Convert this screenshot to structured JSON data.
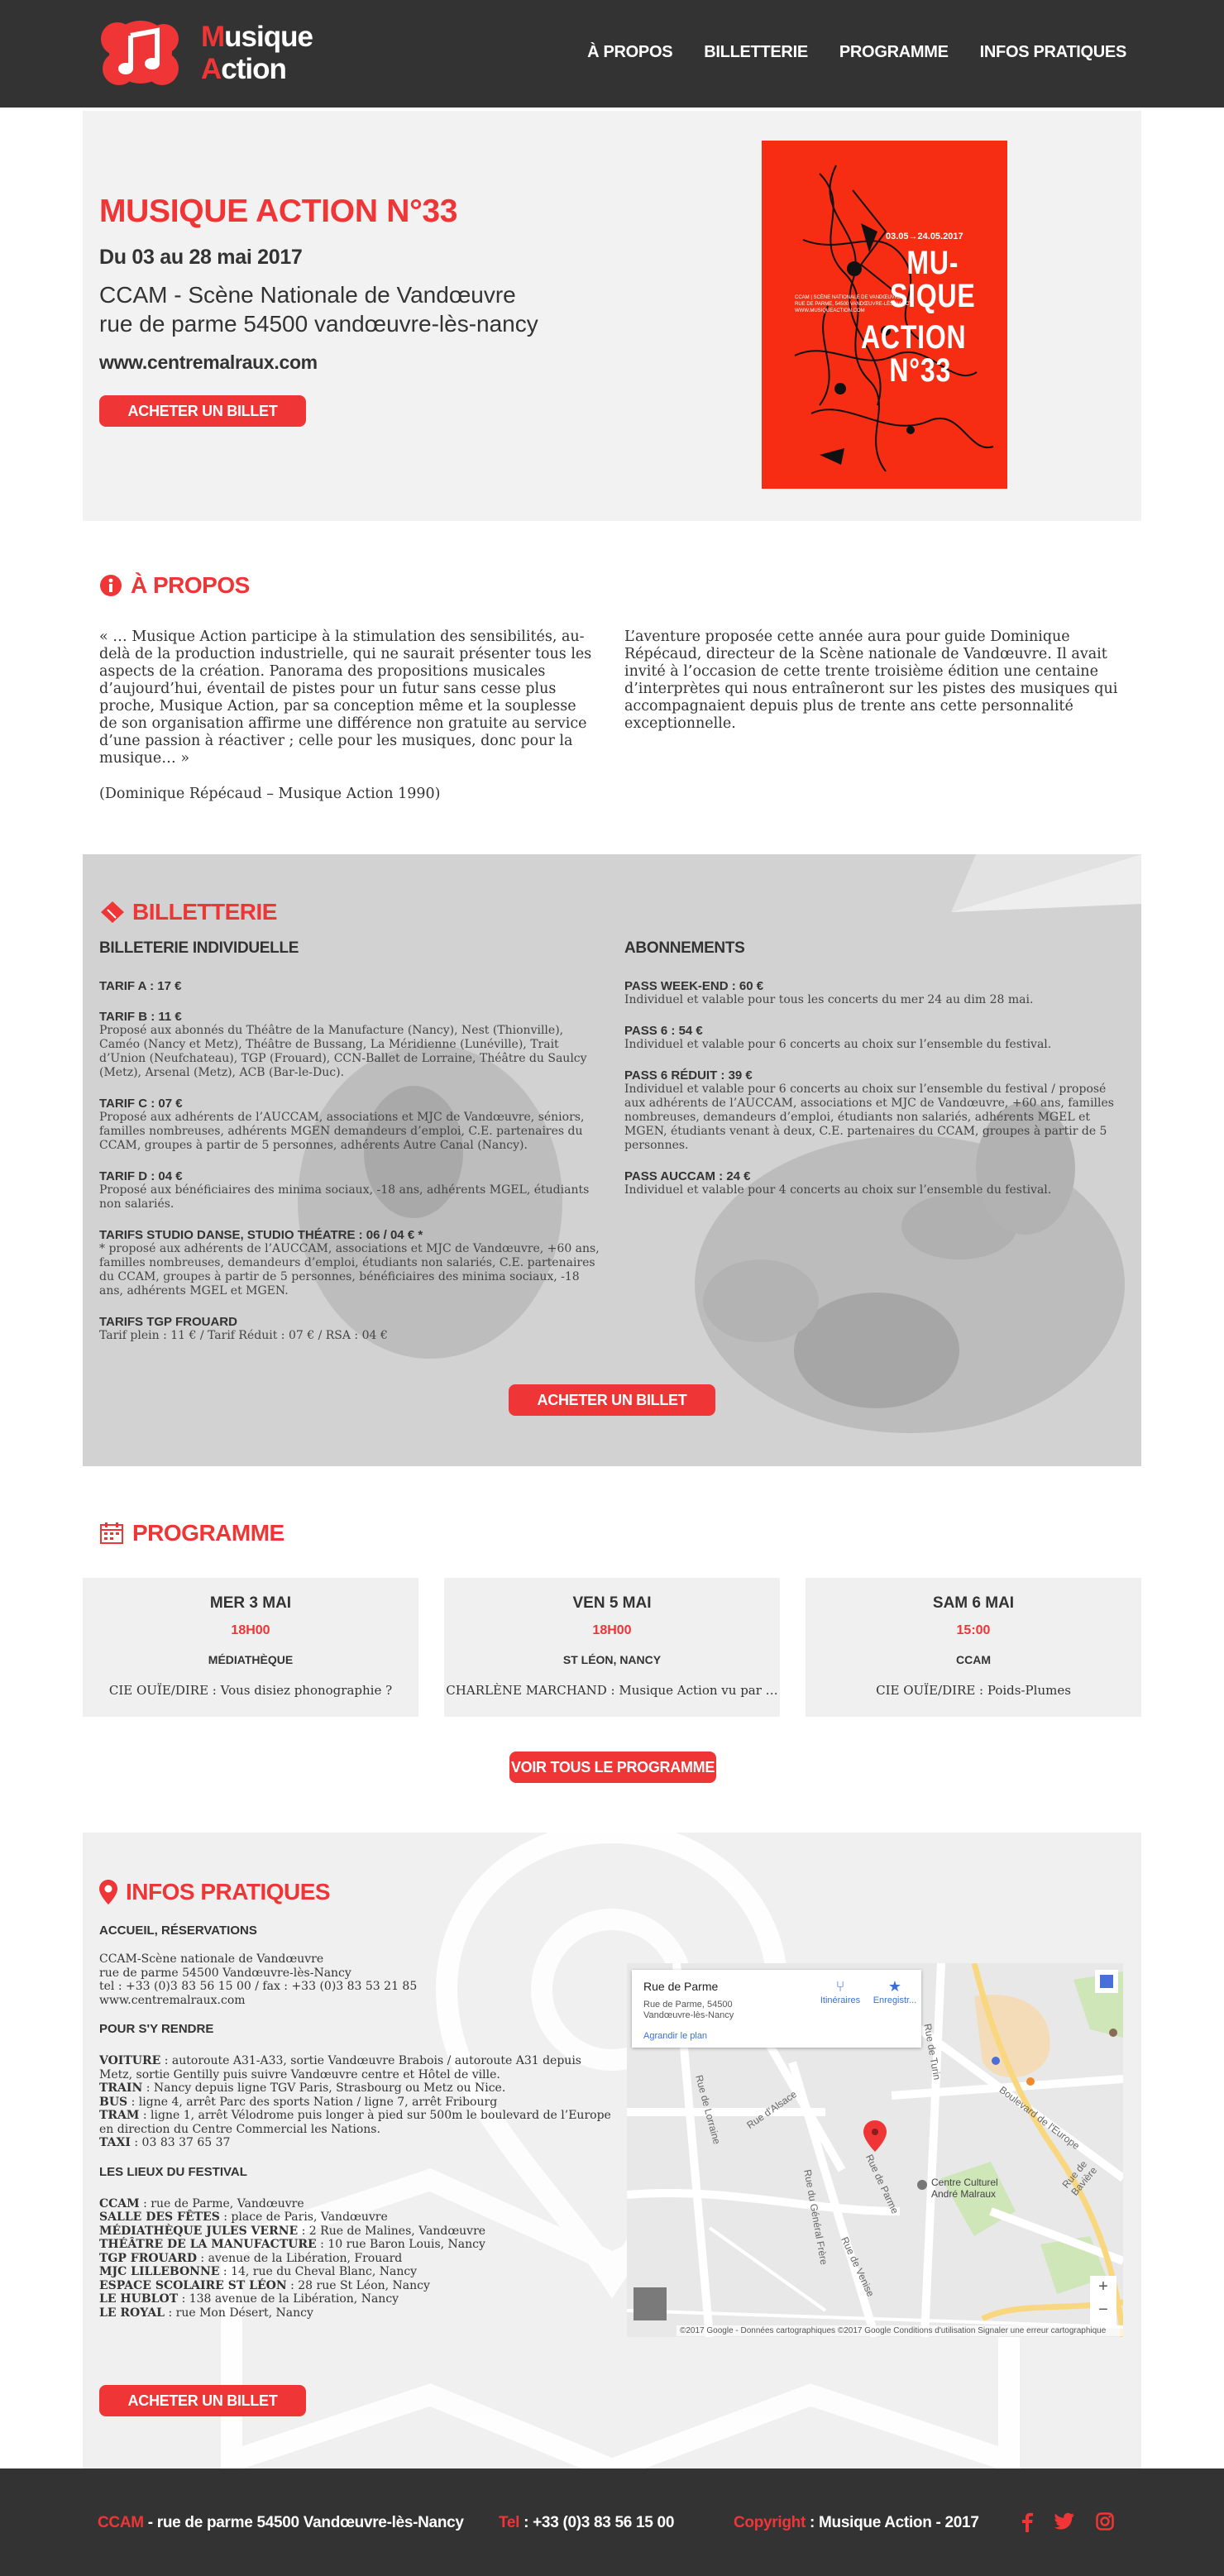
{
  "header": {
    "logo_line1": "Musique",
    "logo_line2": "Action",
    "nav": [
      "À PROPOS",
      "BILLETTERIE",
      "PROGRAMME",
      "INFOS PRATIQUES"
    ]
  },
  "hero": {
    "title": "MUSIQUE ACTION N°33",
    "dates": "Du 03 au 28 mai 2017",
    "venue_line1": "CCAM - Scène Nationale de Vandœuvre",
    "venue_line2": "rue de parme 54500 vandœuvre-lès-nancy",
    "website": "www.centremalraux.com",
    "cta": "ACHETER UN BILLET",
    "poster": {
      "dates": "03.05→24.05.2017",
      "small_lines": [
        "CCAM | SCÈNE NATIONALE DE VANDŒUVRE",
        "RUE DE PARME, 54500 VANDŒUVRE-LÈS-NANCY",
        "WWW.MUSIQUEACTION.COM"
      ],
      "words": [
        "MU-",
        "SIQUE",
        "ACTION",
        "N°33"
      ]
    }
  },
  "apropos": {
    "title": "À PROPOS",
    "left_p1": "« … Musique Action participe à la stimulation des sensibilités, au-delà de la production industrielle, qui ne saurait présenter tous les aspects de la création. Panorama des propositions musicales d’aujourd’hui, éventail de pistes pour un futur sans cesse plus proche, Musique Action, par sa conception même et la souplesse de son organisation affirme une différence non gratuite au service d’une passion à réactiver ; celle pour les musiques, donc pour la musique… »",
    "left_p2": "(Dominique Répécaud – Musique Action 1990)",
    "right_p1": "L’aventure proposée cette année aura pour guide Dominique Répécaud, directeur de la Scène nationale de Vandœuvre. Il avait invité à l’occasion de cette trente troisième édition une centaine d’interprètes qui nous entraîneront sur les pistes des musiques qui accompagnaient depuis plus de trente ans cette personnalité exceptionnelle."
  },
  "billetterie": {
    "title": "BILLETTERIE",
    "left_heading": "BILLETERIE INDIVIDUELLE",
    "right_heading": "ABONNEMENTS",
    "tarifs": [
      {
        "label": "TARIF A : 17 €",
        "text": ""
      },
      {
        "label": "TARIF B : 11 €",
        "text": "Proposé aux abonnés du Théâtre de la Manufacture (Nancy), Nest (Thionville), Caméo (Nancy et Metz), Théâtre de Bussang, La Méridienne (Lunéville), Trait d’Union (Neufchateau), TGP (Frouard), CCN-Ballet de Lorraine, Théâtre du Saulcy (Metz), Arsenal (Metz), ACB (Bar-le-Duc)."
      },
      {
        "label": "TARIF C : 07 €",
        "text": "Proposé aux adhérents de l’AUCCAM, associations et MJC de Vandœuvre, séniors, familles nombreuses, adhérents MGEN demandeurs d’emploi, C.E. partenaires du CCAM, groupes à partir de 5 personnes, adhérents Autre Canal (Nancy)."
      },
      {
        "label": "TARIF D : 04 €",
        "text": "Proposé aux bénéficiaires des minima sociaux, -18 ans, adhérents MGEL, étudiants non salariés."
      },
      {
        "label": "TARIFS STUDIO DANSE, STUDIO THÉATRE : 06 / 04 € *",
        "text": "* proposé aux adhérents de l’AUCCAM, associations et MJC de Vandœuvre, +60 ans, familles nombreuses, demandeurs d’emploi, étudiants non salariés, C.E. partenaires du CCAM, groupes à partir de 5 personnes, bénéficiaires des minima sociaux, -18 ans, adhérents MGEL et MGEN."
      },
      {
        "label": "TARIFS TGP FROUARD",
        "text": "Tarif plein : 11 € / Tarif Réduit : 07 € / RSA : 04 €"
      }
    ],
    "abonnements": [
      {
        "label": "PASS WEEK-END : 60 €",
        "text": "Individuel et valable pour tous les concerts du mer 24 au dim 28 mai."
      },
      {
        "label": "PASS 6 : 54 €",
        "text": "Individuel et valable pour 6 concerts au choix sur l’ensemble du festival."
      },
      {
        "label": "PASS 6 RÉDUIT : 39 €",
        "text": "Individuel et valable pour 6 concerts au choix sur l’ensemble du festival / proposé aux adhérents de l’AUCCAM, associations et MJC de Vandœuvre, +60 ans, familles nombreuses, demandeurs d’emploi, étudiants non salariés, adhérents MGEL et MGEN, étudiants venant à deux, C.E. partenaires du CCAM, groupes à partir de 5 personnes."
      },
      {
        "label": "PASS AUCCAM : 24 €",
        "text": "Individuel et valable pour 4 concerts au choix sur l’ensemble du festival."
      }
    ],
    "cta": "ACHETER UN BILLET"
  },
  "programme": {
    "title": "PROGRAMME",
    "cards": [
      {
        "date": "MER 3 MAI",
        "hour": "18H00",
        "place": "MÉDIATHÈQUE",
        "artist": "CIE OUÏE/DIRE : Vous disiez phonographie ?"
      },
      {
        "date": "VEN 5 MAI",
        "hour": "18H00",
        "place": "ST LÉON, NANCY",
        "artist": "CHARLÈNE MARCHAND : Musique Action vu par …"
      },
      {
        "date": "SAM 6 MAI",
        "hour": "15:00",
        "place": "CCAM",
        "artist": "CIE OUÏE/DIRE : Poids-Plumes"
      }
    ],
    "cta": "VOIR TOUS LE PROGRAMME"
  },
  "infos": {
    "title": "INFOS PRATIQUES",
    "accueil_heading": "ACCUEIL, RÉSERVATIONS",
    "accueil_lines": [
      "CCAM-Scène nationale de Vandœuvre",
      "rue de parme 54500 Vandœuvre-lès-Nancy",
      "tel : +33 (0)3 83 56 15 00 / fax : +33 (0)3 83 53 21 85",
      "www.centremalraux.com"
    ],
    "rendre_heading": "POUR S'Y RENDRE",
    "rendre": [
      {
        "k": "VOITURE",
        "v": " : autoroute A31-A33, sortie Vandœuvre Brabois / autoroute A31 depuis Metz, sortie Gentilly puis suivre Vandœuvre centre et Hôtel de ville."
      },
      {
        "k": "TRAIN",
        "v": " : Nancy depuis ligne TGV Paris, Strasbourg ou Metz ou Nice."
      },
      {
        "k": "BUS",
        "v": " : ligne 4, arrêt Parc des sports Nation / ligne 7, arrêt Fribourg"
      },
      {
        "k": "TRAM",
        "v": " : ligne 1, arrêt Vélodrome puis longer à pied sur 500m le boulevard de l’Europe en direction du Centre Commercial les Nations."
      },
      {
        "k": "TAXI",
        "v": " : 03 83 37 65 37"
      }
    ],
    "lieux_heading": "LES LIEUX DU FESTIVAL",
    "lieux": [
      {
        "k": "CCAM",
        "v": " : rue de Parme, Vandœuvre"
      },
      {
        "k": "SALLE DES FÊTES",
        "v": " : place de Paris, Vandœuvre"
      },
      {
        "k": "MÉDIATHÈQUE JULES VERNE",
        "v": " : 2 Rue de Malines, Vandœuvre"
      },
      {
        "k": "THÉÂTRE DE LA MANUFACTURE",
        "v": " : 10 rue Baron Louis, Nancy"
      },
      {
        "k": "TGP FROUARD",
        "v": " : avenue de la Libération, Frouard"
      },
      {
        "k": "MJC LILLEBONNE",
        "v": " : 14, rue du Cheval Blanc, Nancy"
      },
      {
        "k": "ESPACE SCOLAIRE ST LÉON",
        "v": " : 28 rue St Léon, Nancy"
      },
      {
        "k": "LE HUBLOT",
        "v": " : 138 avenue de la Libération, Nancy"
      },
      {
        "k": "LE ROYAL",
        "v": " : rue Mon Désert, Nancy"
      }
    ],
    "cta": "ACHETER UN BILLET",
    "map": {
      "card_title": "Rue de Parme",
      "card_address": "Rue de Parme, 54500 Vandœuvre-lès-Nancy",
      "card_link": "Agrandir le plan",
      "directions": "Itinéraires",
      "save": "Enregistr...",
      "poi": "Centre Culturel André Malraux",
      "streets": [
        "Rue de Lorraine",
        "Rue d'Alsace",
        "Rue de Parme",
        "Rue de Venise",
        "Boulevard de l'Europe",
        "Rue du Général Frère",
        "Rue de Turin",
        "Rue de Bavière"
      ],
      "footer": "©2017 Google - Données cartographiques ©2017 Google   Conditions d'utilisation   Signaler une erreur cartographique",
      "zoom_in": "+",
      "zoom_out": "−"
    }
  },
  "footer": {
    "addr_key": "CCAM",
    "addr_val": " - rue de parme 54500 Vandœuvre-lès-Nancy",
    "tel_key": "Tel",
    "tel_val": " : +33 (0)3 83 56 15 00",
    "copy_key": "Copyright",
    "copy_val": " : Musique Action - 2017",
    "social": [
      "facebook-icon",
      "twitter-icon",
      "instagram-icon"
    ]
  },
  "colors": {
    "accent": "#ef3535",
    "header": "#333333",
    "panel": "#f2f2f2"
  }
}
